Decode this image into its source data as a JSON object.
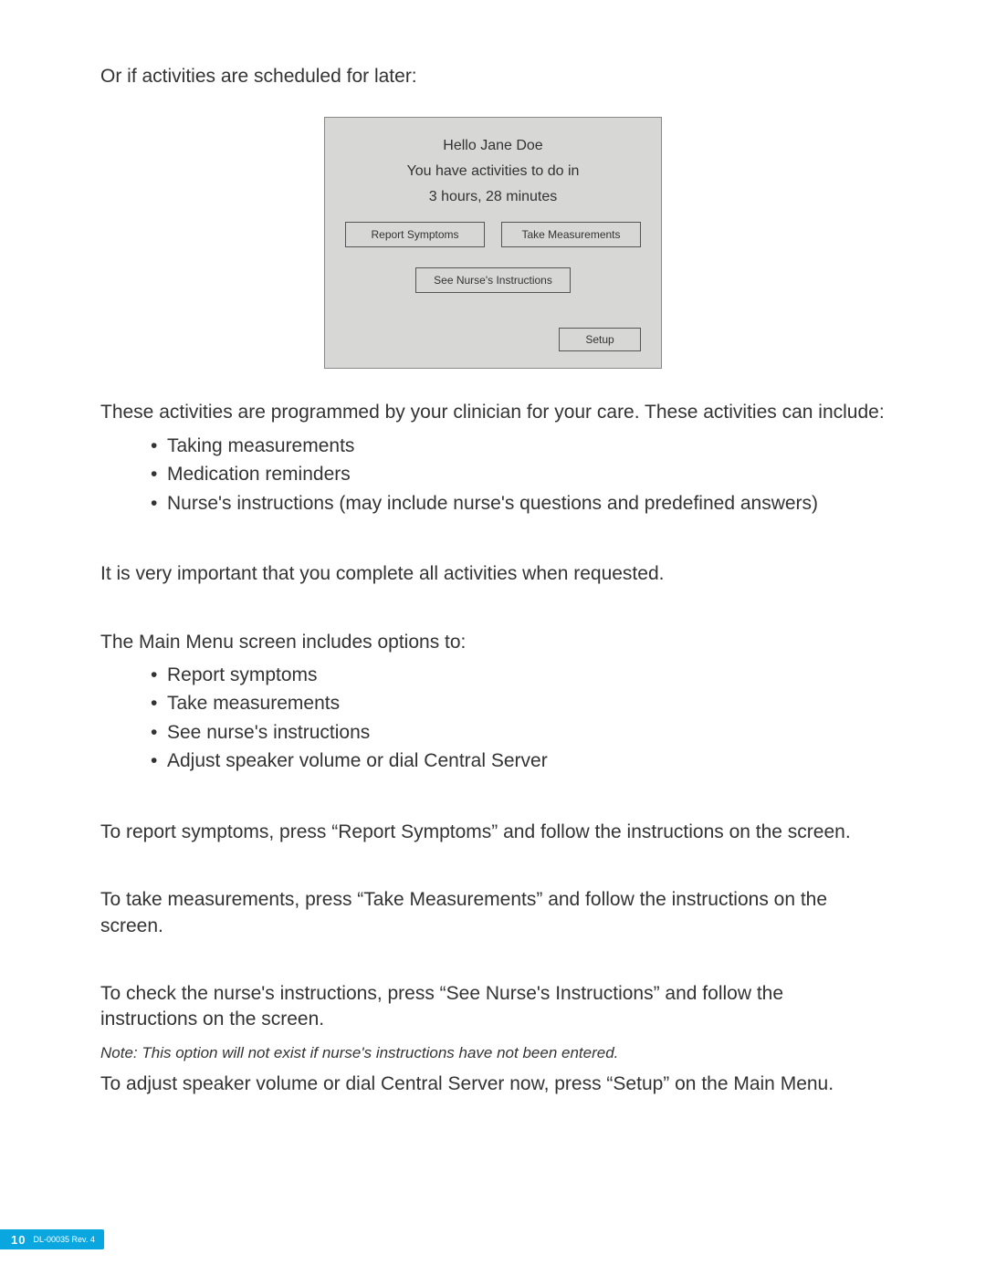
{
  "intro_line": "Or if activities are scheduled for later:",
  "device": {
    "greeting": "Hello Jane Doe",
    "activities_line": "You have activities to do in",
    "time_line": "3 hours, 28 minutes",
    "report_btn": "Report Symptoms",
    "measure_btn": "Take Measurements",
    "nurse_btn": "See Nurse's Instructions",
    "setup_btn": "Setup"
  },
  "para_programmed": "These activities are programmed by your clinician for your care. These activities can include:",
  "activities_list": {
    "i0": "Taking measurements",
    "i1": "Medication reminders",
    "i2": "Nurse's instructions (may include nurse's questions and predefined answers)"
  },
  "para_important": "It is very important that you complete all activities when requested.",
  "para_mainmenu_intro": "The Main Menu screen includes options to:",
  "mainmenu_list": {
    "i0": "Report symptoms",
    "i1": "Take measurements",
    "i2": "See nurse's instructions",
    "i3": "Adjust speaker volume or dial Central Server"
  },
  "para_report": "To report symptoms, press “Report Symptoms” and follow the instructions on the screen.",
  "para_take": "To take measurements, press “Take Measurements” and follow the instructions on the screen.",
  "para_check": "To check the nurse's instructions, press “See Nurse's Instructions” and follow the instructions on the screen.",
  "note": "Note: This option will not exist if nurse's instructions have not been entered.",
  "para_setup": "To adjust speaker volume or dial Central Server now, press “Setup” on the Main Menu.",
  "footer": {
    "page": "10",
    "doc": "DL-00035 Rev. 4"
  }
}
